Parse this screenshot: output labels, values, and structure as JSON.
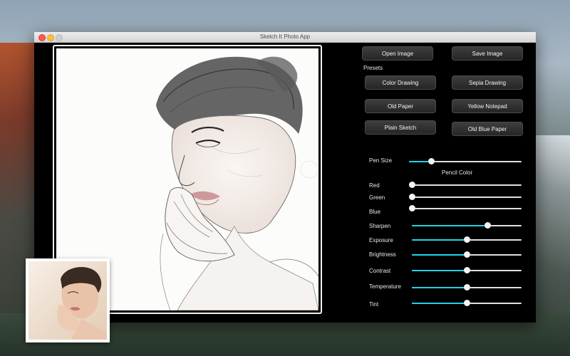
{
  "window": {
    "title": "Sketch It Photo App"
  },
  "toolbar": {
    "open_label": "Open Image",
    "save_label": "Save Image"
  },
  "presets": {
    "heading": "Presets",
    "items": [
      "Color Drawing",
      "Sepia Drawing",
      "Old Paper",
      "Yellow Notepad",
      "Plain Sketch",
      "Old Blue Paper"
    ]
  },
  "adjustments": {
    "pen_size": {
      "label": "Pen Size",
      "value": 0.2
    },
    "pencil_color_heading": "Pencil Color",
    "red": {
      "label": "Red",
      "value": 0.0
    },
    "green": {
      "label": "Green",
      "value": 0.0
    },
    "blue": {
      "label": "Blue",
      "value": 0.0
    },
    "sharpen": {
      "label": "Sharpen",
      "value": 0.69
    },
    "exposure": {
      "label": "Exposure",
      "value": 0.5
    },
    "brightness": {
      "label": "Brightness",
      "value": 0.5
    },
    "contrast": {
      "label": "Contrast",
      "value": 0.5
    },
    "temperature": {
      "label": "Temperature",
      "value": 0.5
    },
    "tint": {
      "label": "Tint",
      "value": 0.5
    }
  },
  "colors": {
    "accent": "#1fd4e4",
    "window_bg": "#000000",
    "button_bg": "#2f2f2f"
  }
}
